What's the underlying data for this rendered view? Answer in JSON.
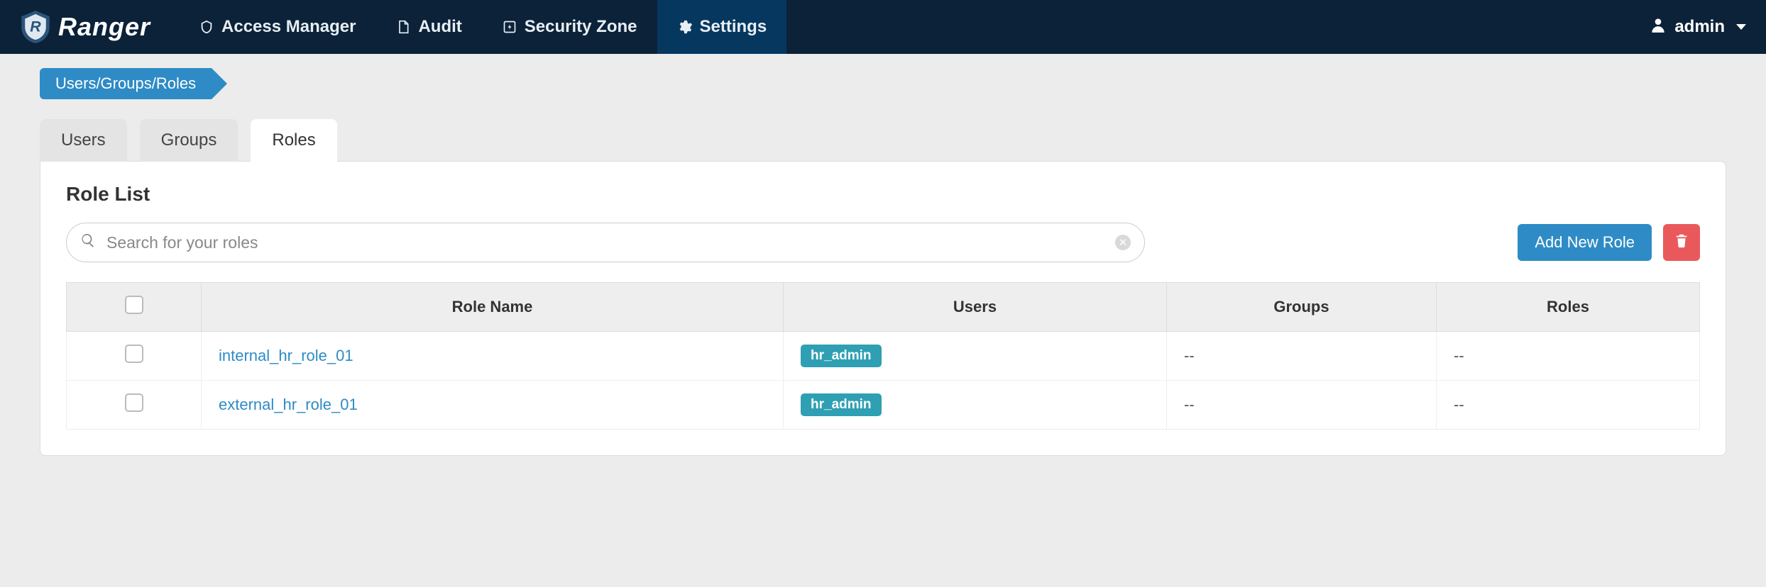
{
  "brand": {
    "name": "Ranger"
  },
  "nav": {
    "items": [
      {
        "label": "Access Manager",
        "icon": "shield-icon"
      },
      {
        "label": "Audit",
        "icon": "file-icon"
      },
      {
        "label": "Security Zone",
        "icon": "bolt-icon"
      },
      {
        "label": "Settings",
        "icon": "gear-icon"
      }
    ],
    "active_index": 3
  },
  "user": {
    "name": "admin"
  },
  "breadcrumb": {
    "label": "Users/Groups/Roles"
  },
  "tabs": {
    "items": [
      {
        "label": "Users"
      },
      {
        "label": "Groups"
      },
      {
        "label": "Roles"
      }
    ],
    "active_index": 2
  },
  "panel": {
    "title": "Role List",
    "search_placeholder": "Search for your roles",
    "add_button_label": "Add New Role"
  },
  "table": {
    "columns": [
      "",
      "Role Name",
      "Users",
      "Groups",
      "Roles"
    ],
    "rows": [
      {
        "name": "internal_hr_role_01",
        "users": [
          "hr_admin"
        ],
        "groups": "--",
        "roles": "--"
      },
      {
        "name": "external_hr_role_01",
        "users": [
          "hr_admin"
        ],
        "groups": "--",
        "roles": "--"
      }
    ]
  }
}
